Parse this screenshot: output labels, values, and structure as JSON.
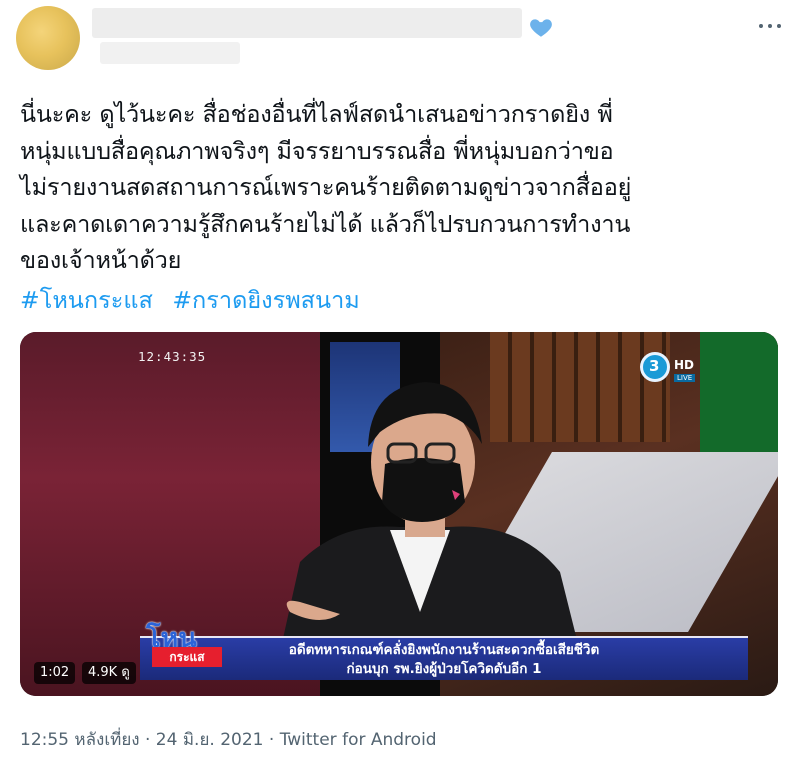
{
  "tweet": {
    "text": "นี่นะคะ ดูไว้นะคะ สื่อช่องอื่นที่ไลฟ์สดนำเสนอข่าวกราดยิง พี่\nหนุ่มแบบสื่อคุณภาพจริงๆ มีจรรยาบรรณสื่อ พี่หนุ่มบอกว่าขอ\nไม่รายงานสดสถานการณ์เพราะคนร้ายติดตามดูข่าวจากสื่ออยู่\nและคาดเดาความรู้สึกคนร้ายไม่ได้ แล้วก็ไปรบกวนการทำงาน\nของเจ้าหน้าด้วย",
    "hashtags": [
      "#โหนกระแส",
      "#กราดยิงรพสนาม"
    ]
  },
  "header": {
    "like_icon": "heart-icon",
    "more_icon": "more-options-icon",
    "like_color": "#6cb2eb"
  },
  "video": {
    "clock": "12:43:35",
    "channel": {
      "number": "3",
      "hd": "HD",
      "live": "LIVE"
    },
    "show_logo": {
      "top": "โหน",
      "bottom": "กระแส"
    },
    "caption_line1": "อดีตทหารเกณฑ์คลั่งยิงพนักงานร้านสะดวกซื้อเสียชีวิต",
    "caption_line2": "ก่อนบุก รพ.ยิงผู้ป่วยโควิดดับอีก 1",
    "duration": "1:02",
    "views": "4.9K ดู"
  },
  "footer": {
    "meta": "12:55 หลังเที่ยง · 24 มิ.ย. 2021 · Twitter for Android"
  },
  "colors": {
    "hashtag": "#1d9bf0",
    "text": "#0f1419",
    "muted": "#536471"
  }
}
